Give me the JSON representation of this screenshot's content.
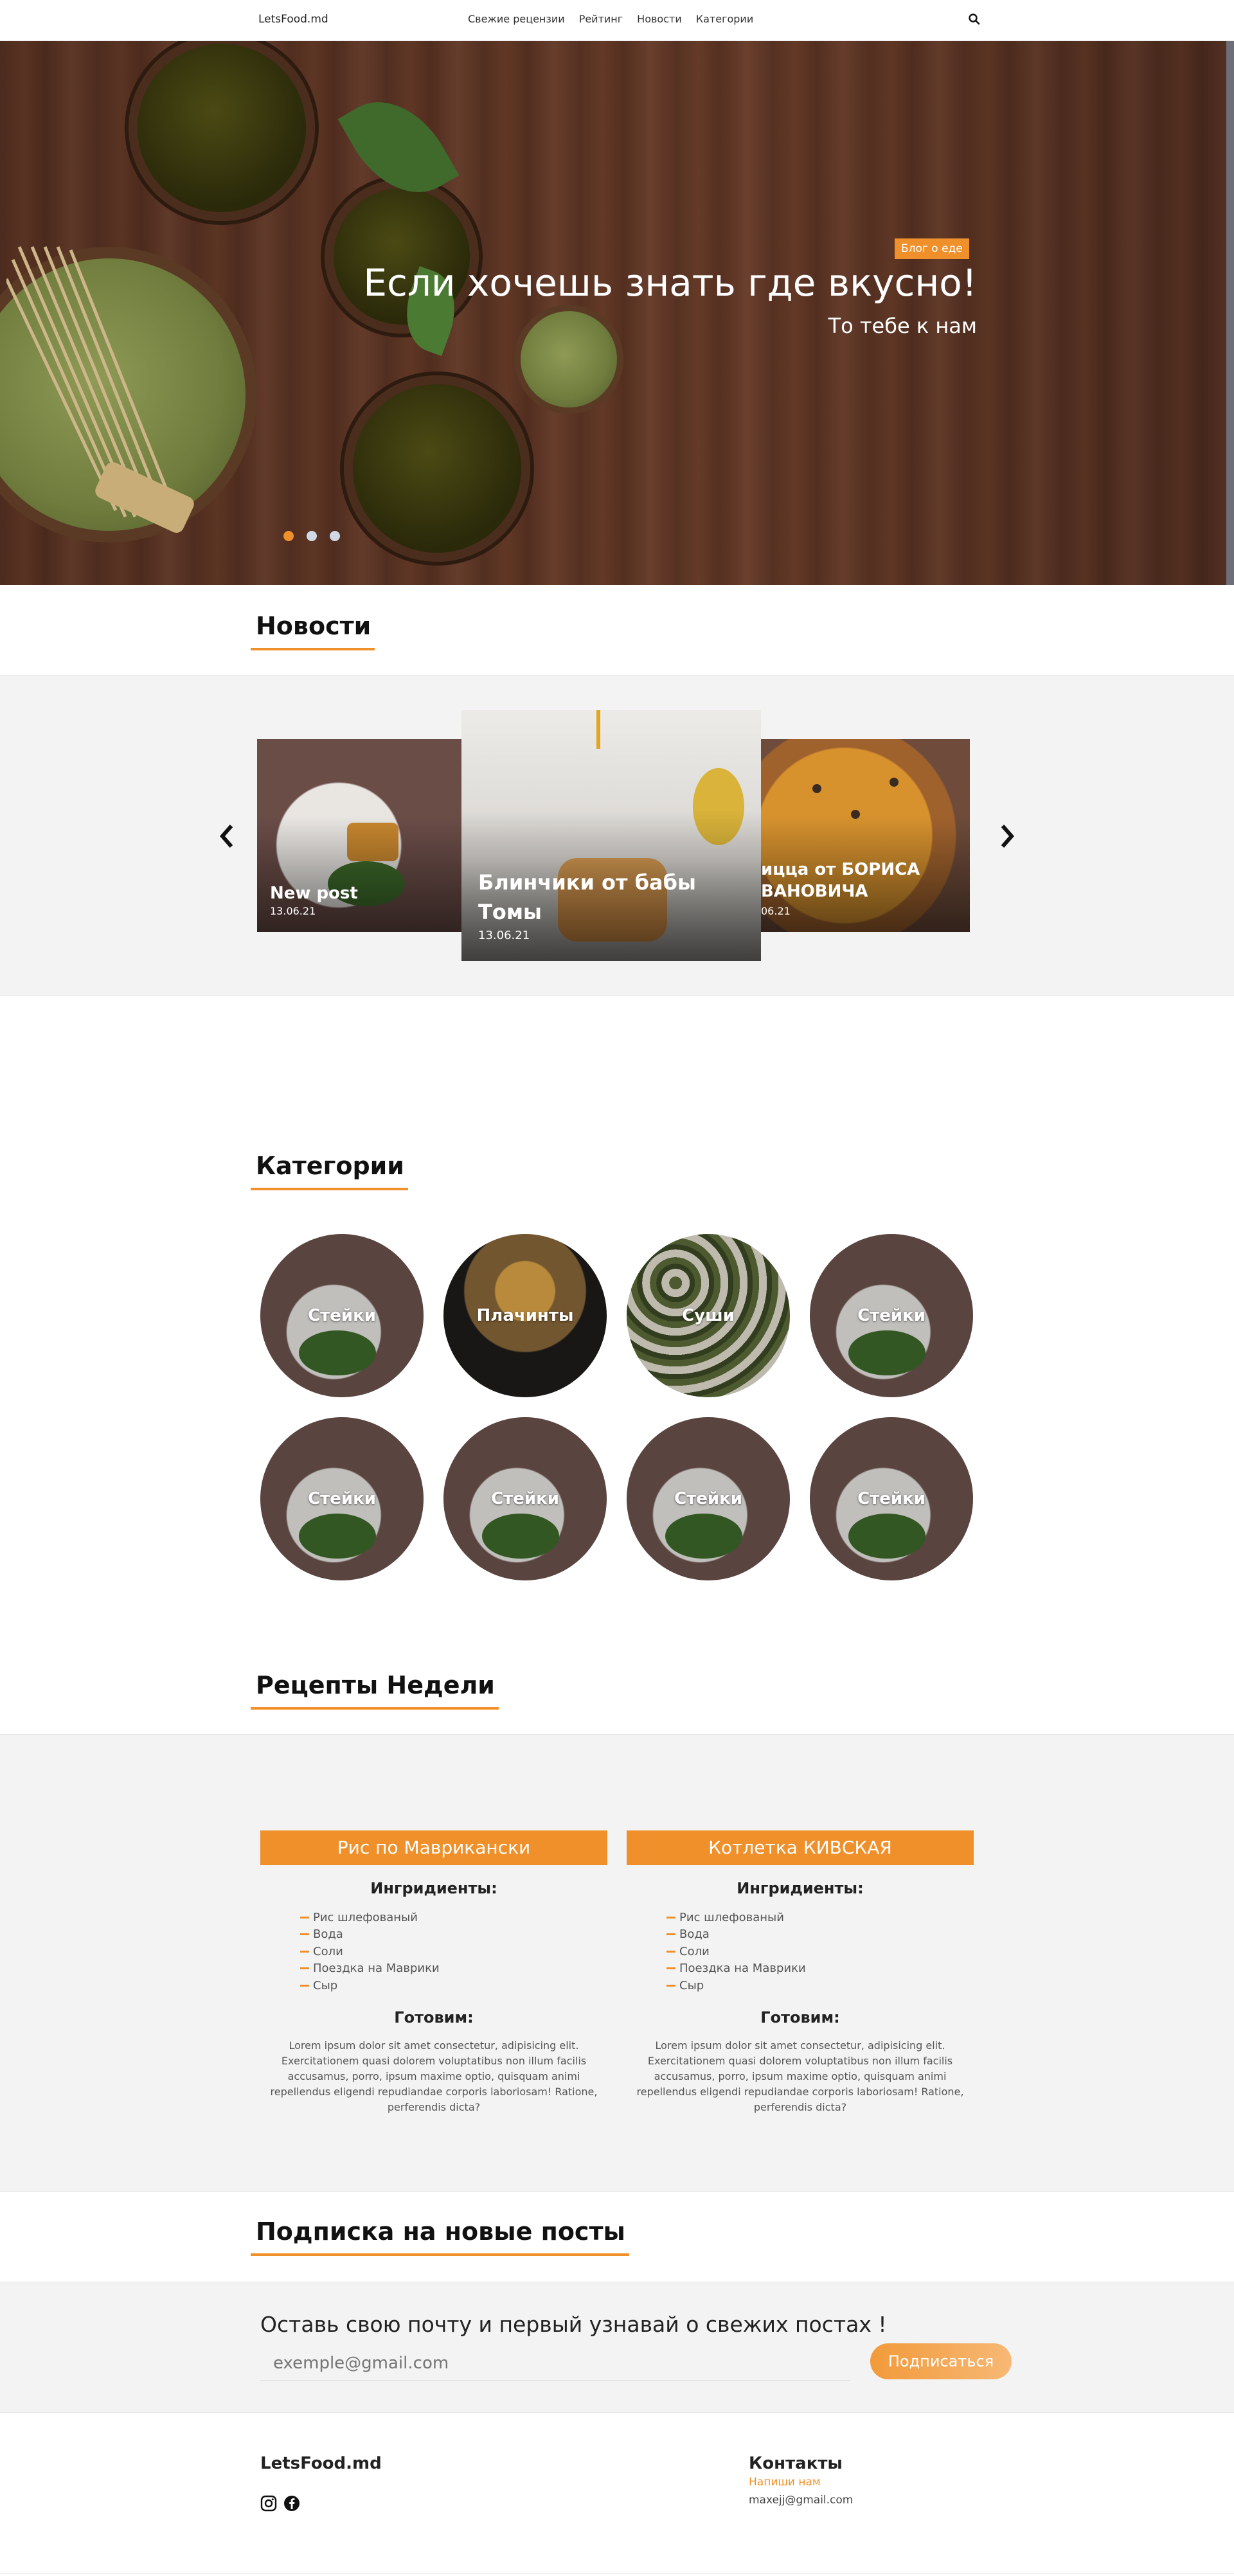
{
  "header": {
    "brand": "LetsFood.md",
    "nav": [
      "Свежие рецензии",
      "Рейтинг",
      "Новости",
      "Категории"
    ],
    "search_icon": "search-icon"
  },
  "hero": {
    "tag": "Блог о еде",
    "title": "Если хочешь знать где вкусно!",
    "subtitle": "То тебе к нам",
    "dots_active": 0,
    "dots_count": 3
  },
  "news": {
    "title": "Новости",
    "cards": [
      {
        "title": "New post",
        "date": "13.06.21"
      },
      {
        "title": "Блинчики от бабы Томы",
        "date": "13.06.21"
      },
      {
        "title": "ицца от БОРИСА ВАНОВИЧА",
        "date": "06.21"
      }
    ]
  },
  "categories": {
    "title": "Категории",
    "items": [
      "Стейки",
      "Плачинты",
      "Суши",
      "Стейки",
      "Стейки",
      "Стейки",
      "Стейки",
      "Стейки"
    ]
  },
  "recipes": {
    "title": "Рецепты Недели",
    "items": [
      {
        "name": "Рис по Маврикански",
        "ingredients_label": "Ингридиенты:",
        "ingredients": [
          "Рис шлефованый",
          "Вода",
          "Соли",
          "Поездка на Маврики",
          "Сыр"
        ],
        "method_label": "Готовим:",
        "method": "Lorem ipsum dolor sit amet consectetur, adipisicing elit. Exercitationem quasi dolorem voluptatibus non illum facilis accusamus, porro, ipsum maxime optio, quisquam animi repellendus eligendi repudiandae corporis laboriosam! Ratione, perferendis dicta?"
      },
      {
        "name": "Котлетка КИВСКАЯ",
        "ingredients_label": "Ингридиенты:",
        "ingredients": [
          "Рис шлефованый",
          "Вода",
          "Соли",
          "Поездка на Маврики",
          "Сыр"
        ],
        "method_label": "Готовим:",
        "method": "Lorem ipsum dolor sit amet consectetur, adipisicing elit. Exercitationem quasi dolorem voluptatibus non illum facilis accusamus, porro, ipsum maxime optio, quisquam animi repellendus eligendi repudiandae corporis laboriosam! Ratione, perferendis dicta?"
      }
    ]
  },
  "subscribe": {
    "title": "Подписка на новые посты",
    "heading": "Оставь свою почту и первый узнавай о свежих постах !",
    "placeholder": "exemple@gmail.com",
    "button": "Подписаться"
  },
  "footer": {
    "brand": "LetsFood.md",
    "icons": [
      "instagram-icon",
      "facebook-icon"
    ],
    "contacts_title": "Контакты",
    "write_us": "Напиши нам",
    "email": "maxejj@gmail.com"
  },
  "colors": {
    "accent": "#f0902a",
    "band": "#f3f3f3"
  }
}
